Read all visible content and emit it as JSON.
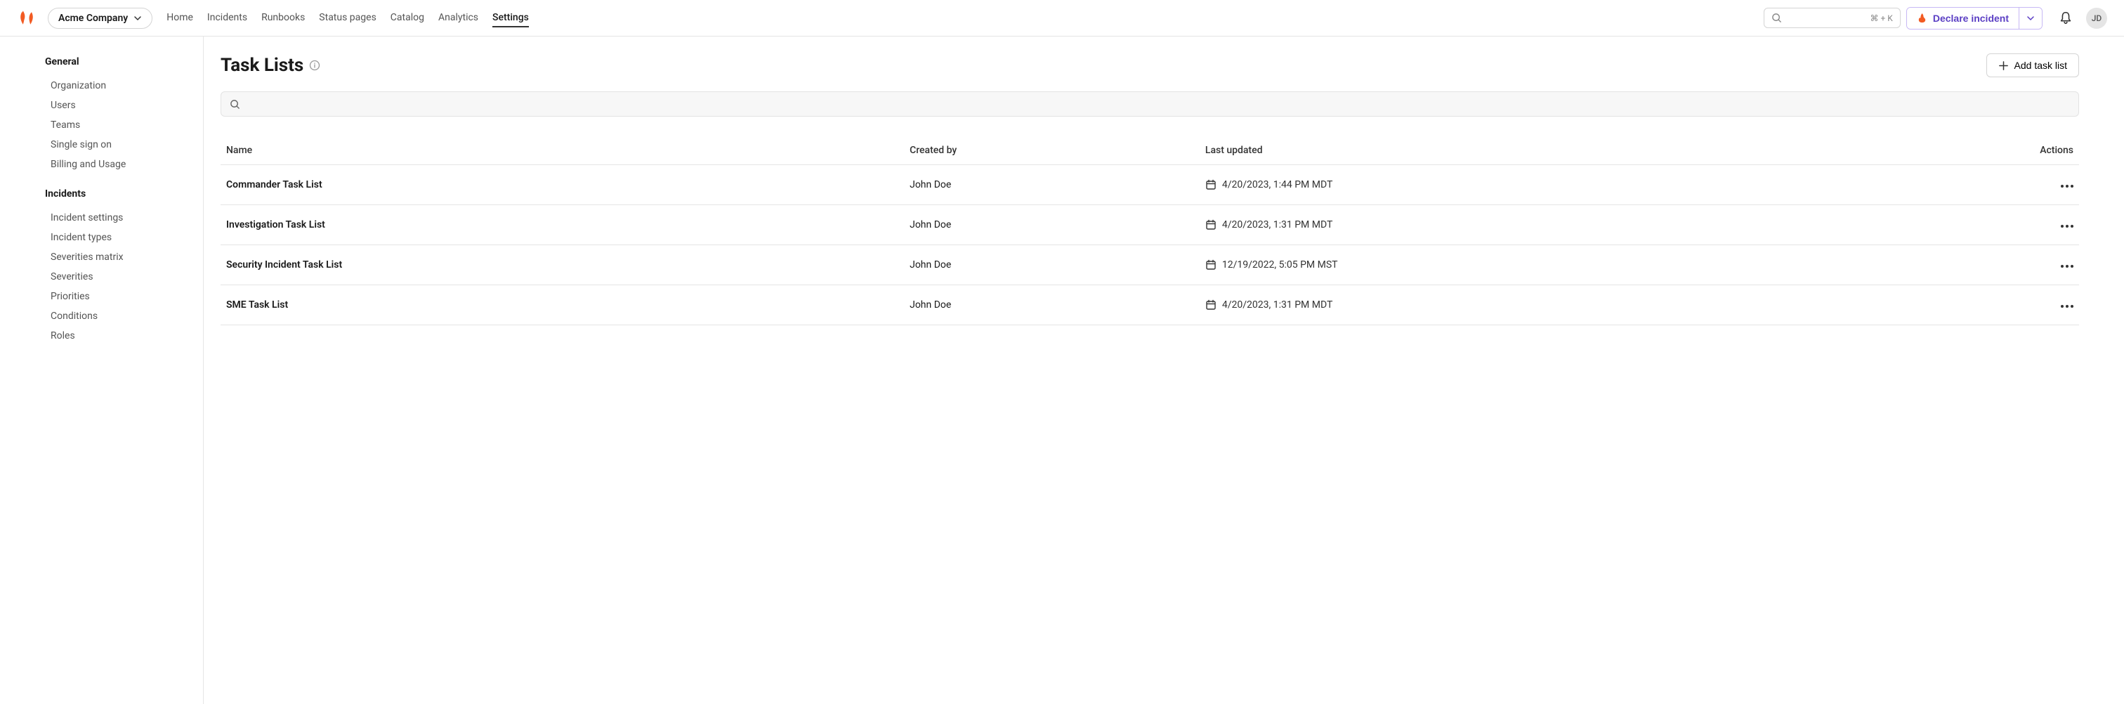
{
  "header": {
    "company": "Acme Company",
    "nav": {
      "home": "Home",
      "incidents": "Incidents",
      "runbooks": "Runbooks",
      "status_pages": "Status pages",
      "catalog": "Catalog",
      "analytics": "Analytics",
      "settings": "Settings"
    },
    "search_shortcut": "⌘   + K",
    "declare_label": "Declare incident",
    "avatar_initials": "JD"
  },
  "sidebar": {
    "group1_title": "General",
    "group1": {
      "organization": "Organization",
      "users": "Users",
      "teams": "Teams",
      "sso": "Single sign on",
      "billing": "Billing and Usage"
    },
    "group2_title": "Incidents",
    "group2": {
      "incident_settings": "Incident settings",
      "incident_types": "Incident types",
      "severities_matrix": "Severities matrix",
      "severities": "Severities",
      "priorities": "Priorities",
      "conditions": "Conditions",
      "roles": "Roles"
    }
  },
  "page": {
    "title": "Task Lists",
    "add_button_label": "Add task list",
    "columns": {
      "name": "Name",
      "created_by": "Created by",
      "last_updated": "Last updated",
      "actions": "Actions"
    },
    "rows": [
      {
        "name": "Commander Task List",
        "created_by": "John Doe",
        "last_updated": "4/20/2023, 1:44 PM MDT"
      },
      {
        "name": "Investigation Task List",
        "created_by": "John Doe",
        "last_updated": "4/20/2023, 1:31 PM MDT"
      },
      {
        "name": "Security Incident Task List",
        "created_by": "John Doe",
        "last_updated": "12/19/2022, 5:05 PM MST"
      },
      {
        "name": "SME Task List",
        "created_by": "John Doe",
        "last_updated": "4/20/2023, 1:31 PM MDT"
      }
    ]
  }
}
